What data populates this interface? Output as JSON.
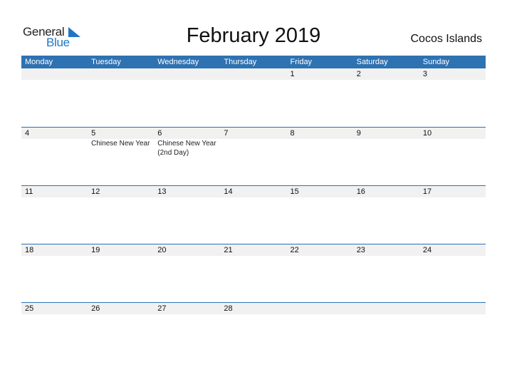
{
  "logo": {
    "text_general": "General",
    "text_blue": "Blue"
  },
  "title": "February 2019",
  "country": "Cocos Islands",
  "colors": {
    "header_bg": "#2e72b2",
    "date_strip": "#f1f1f1",
    "logo_blue": "#1f77c4"
  },
  "weekdays": [
    "Monday",
    "Tuesday",
    "Wednesday",
    "Thursday",
    "Friday",
    "Saturday",
    "Sunday"
  ],
  "weeks": [
    [
      {
        "day": ""
      },
      {
        "day": ""
      },
      {
        "day": ""
      },
      {
        "day": ""
      },
      {
        "day": "1"
      },
      {
        "day": "2"
      },
      {
        "day": "3"
      }
    ],
    [
      {
        "day": "4"
      },
      {
        "day": "5",
        "event": "Chinese New Year"
      },
      {
        "day": "6",
        "event": "Chinese New Year (2nd Day)"
      },
      {
        "day": "7"
      },
      {
        "day": "8"
      },
      {
        "day": "9"
      },
      {
        "day": "10"
      }
    ],
    [
      {
        "day": "11"
      },
      {
        "day": "12"
      },
      {
        "day": "13"
      },
      {
        "day": "14"
      },
      {
        "day": "15"
      },
      {
        "day": "16"
      },
      {
        "day": "17"
      }
    ],
    [
      {
        "day": "18"
      },
      {
        "day": "19"
      },
      {
        "day": "20"
      },
      {
        "day": "21"
      },
      {
        "day": "22"
      },
      {
        "day": "23"
      },
      {
        "day": "24"
      }
    ],
    [
      {
        "day": "25"
      },
      {
        "day": "26"
      },
      {
        "day": "27"
      },
      {
        "day": "28"
      },
      {
        "day": ""
      },
      {
        "day": ""
      },
      {
        "day": ""
      }
    ]
  ]
}
